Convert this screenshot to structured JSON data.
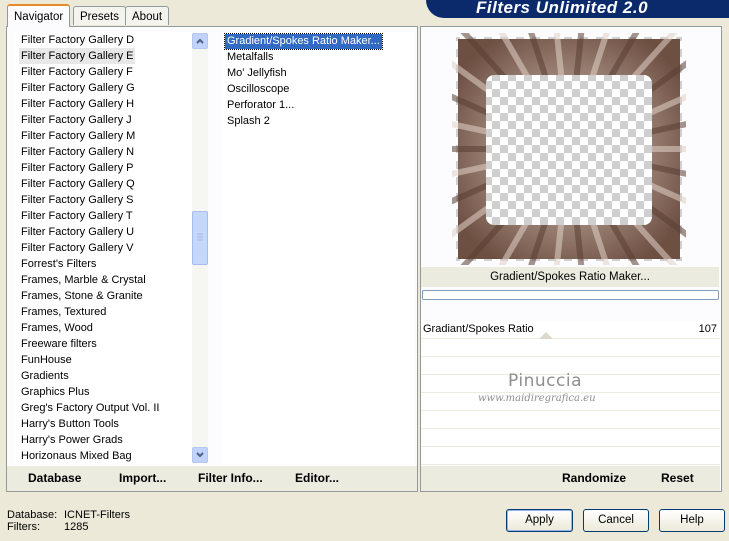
{
  "tabs": [
    "Navigator",
    "Presets",
    "About"
  ],
  "banner": "Filters Unlimited 2.0",
  "categories": [
    "Filter Factory Gallery D",
    "Filter Factory Gallery E",
    "Filter Factory Gallery F",
    "Filter Factory Gallery G",
    "Filter Factory Gallery H",
    "Filter Factory Gallery J",
    "Filter Factory Gallery M",
    "Filter Factory Gallery N",
    "Filter Factory Gallery P",
    "Filter Factory Gallery Q",
    "Filter Factory Gallery S",
    "Filter Factory Gallery T",
    "Filter Factory Gallery U",
    "Filter Factory Gallery V",
    "Forrest's Filters",
    "Frames, Marble & Crystal",
    "Frames, Stone & Granite",
    "Frames, Textured",
    "Frames, Wood",
    "Freeware filters",
    "FunHouse",
    "Gradients",
    "Graphics Plus",
    "Greg's Factory Output Vol. II",
    "Harry's Button Tools",
    "Harry's Power Grads",
    "Horizonaus Mixed Bag"
  ],
  "selected_category": "Filter Factory Gallery E",
  "filters": [
    "Gradient/Spokes Ratio Maker...",
    "Metalfalls",
    "Mo' Jellyfish",
    "Oscilloscope",
    "Perforator 1...",
    "Splash 2"
  ],
  "selected_filter": "Gradient/Spokes Ratio Maker...",
  "links": {
    "database": "Database",
    "import": "Import...",
    "filter_info": "Filter Info...",
    "editor": "Editor..."
  },
  "preview_caption": "Gradient/Spokes Ratio Maker...",
  "parameter": {
    "label": "Gradiant/Spokes Ratio",
    "value": "107"
  },
  "watermark": {
    "name": "Pinuccia",
    "url": "www.maidiregrafica.eu"
  },
  "randomize": "Randomize",
  "reset": "Reset",
  "status": {
    "database_label": "Database:",
    "database_value": "ICNET-Filters",
    "filters_label": "Filters:",
    "filters_value": "1285"
  },
  "buttons": {
    "apply": "Apply",
    "cancel": "Cancel",
    "help": "Help"
  },
  "colors": {
    "banner": "#0b2a6b",
    "selection": "#316ac5",
    "frame": "#7a5c4e"
  }
}
